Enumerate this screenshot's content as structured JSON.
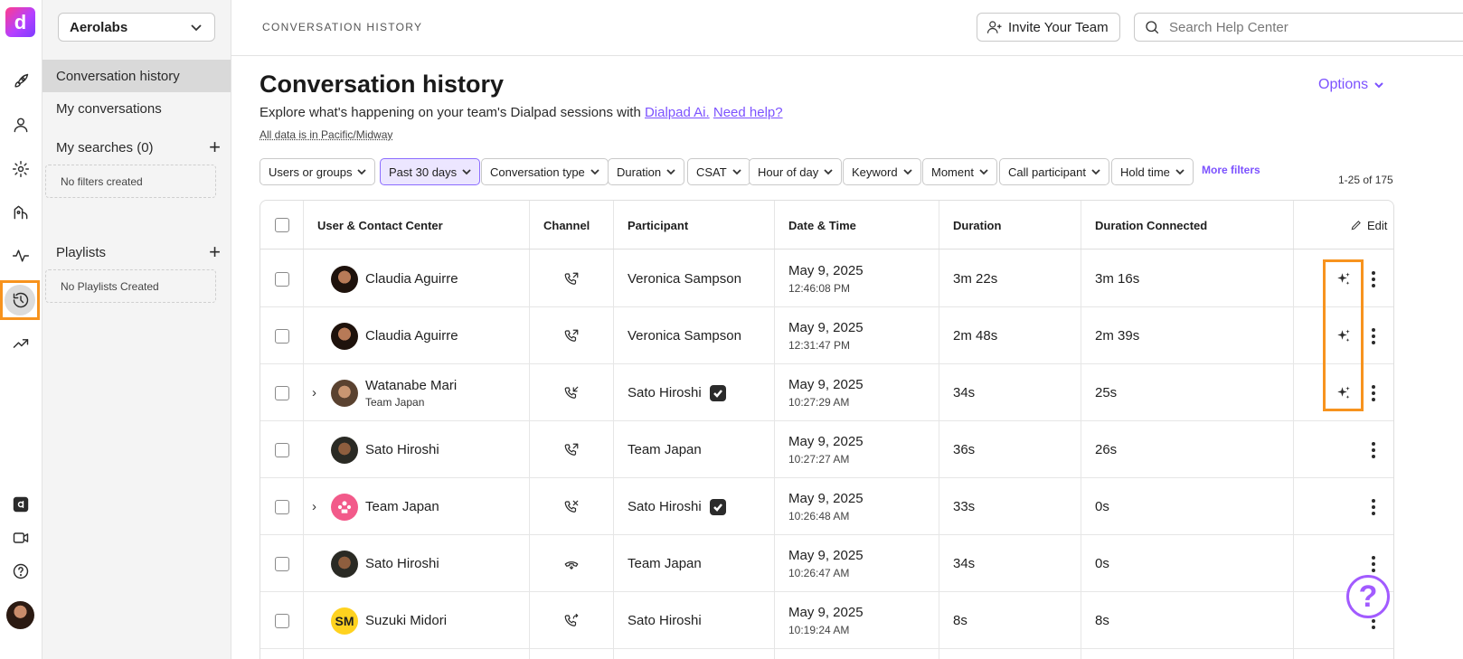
{
  "app": {
    "logo_letter": "d"
  },
  "org": {
    "name": "Aerolabs"
  },
  "subnav": {
    "items": [
      {
        "label": "Conversation history",
        "active": true
      },
      {
        "label": "My conversations",
        "active": false
      }
    ],
    "my_searches": {
      "label": "My searches (0)",
      "empty_text": "No filters created"
    },
    "playlists": {
      "label": "Playlists",
      "empty_text": "No Playlists Created"
    }
  },
  "topbar": {
    "breadcrumb": "CONVERSATION HISTORY",
    "invite_label": "Invite Your Team",
    "search_placeholder": "Search Help Center"
  },
  "page": {
    "title": "Conversation history",
    "subtitle_text": "Explore what's happening on your team's Dialpad sessions with",
    "link_ai": "Dialpad Ai.",
    "link_help": "Need help?",
    "timezone_note": "All data is in Pacific/Midway",
    "options_label": "Options"
  },
  "filters": {
    "chips": [
      {
        "label": "Users or groups",
        "selected": false
      },
      {
        "label": "Past 30 days",
        "selected": true
      },
      {
        "label": "Conversation type",
        "selected": false
      },
      {
        "label": "Duration",
        "selected": false
      },
      {
        "label": "CSAT",
        "selected": false
      },
      {
        "label": "Hour of day",
        "selected": false
      },
      {
        "label": "Keyword",
        "selected": false
      },
      {
        "label": "Moment",
        "selected": false
      },
      {
        "label": "Call participant",
        "selected": false
      },
      {
        "label": "Hold time",
        "selected": false
      }
    ],
    "more_label": "More filters",
    "count": "1-25 of 175"
  },
  "table": {
    "headers": {
      "user": "User & Contact Center",
      "channel": "Channel",
      "participant": "Participant",
      "datetime": "Date & Time",
      "duration": "Duration",
      "connected": "Duration Connected",
      "edit": "Edit"
    },
    "rows": [
      {
        "expandable": false,
        "avatar": "photo-woman",
        "name": "Claudia Aguirre",
        "sub": "",
        "channel": "outgoing-call-icon",
        "participant": "Veronica Sampson",
        "verified": false,
        "date": "May 9, 2025",
        "time": "12:46:08 PM",
        "duration": "3m 22s",
        "connected": "3m 16s",
        "ai": true
      },
      {
        "expandable": false,
        "avatar": "photo-woman",
        "name": "Claudia Aguirre",
        "sub": "",
        "channel": "outgoing-call-icon",
        "participant": "Veronica Sampson",
        "verified": false,
        "date": "May 9, 2025",
        "time": "12:31:47 PM",
        "duration": "2m 48s",
        "connected": "2m 39s",
        "ai": true
      },
      {
        "expandable": true,
        "avatar": "photo-woman-2",
        "name": "Watanabe Mari",
        "sub": "Team Japan",
        "channel": "incoming-call-icon",
        "participant": "Sato Hiroshi",
        "verified": true,
        "date": "May 9, 2025",
        "time": "10:27:29 AM",
        "duration": "34s",
        "connected": "25s",
        "ai": true
      },
      {
        "expandable": false,
        "avatar": "photo-man",
        "name": "Sato Hiroshi",
        "sub": "",
        "channel": "outgoing-call-icon",
        "participant": "Team Japan",
        "verified": false,
        "date": "May 9, 2025",
        "time": "10:27:27 AM",
        "duration": "36s",
        "connected": "26s",
        "ai": false
      },
      {
        "expandable": true,
        "avatar": "team-icon",
        "name": "Team Japan",
        "sub": "",
        "channel": "missed-call-icon",
        "participant": "Sato Hiroshi",
        "verified": true,
        "date": "May 9, 2025",
        "time": "10:26:48 AM",
        "duration": "33s",
        "connected": "0s",
        "ai": false
      },
      {
        "expandable": false,
        "avatar": "photo-man",
        "name": "Sato Hiroshi",
        "sub": "",
        "channel": "hangup-call-icon",
        "participant": "Team Japan",
        "verified": false,
        "date": "May 9, 2025",
        "time": "10:26:47 AM",
        "duration": "34s",
        "connected": "0s",
        "ai": false
      },
      {
        "expandable": false,
        "avatar": "initials",
        "initials": "SM",
        "name": "Suzuki Midori",
        "sub": "",
        "channel": "forward-call-icon",
        "participant": "Sato Hiroshi",
        "verified": false,
        "date": "May 9, 2025",
        "time": "10:19:24 AM",
        "duration": "8s",
        "connected": "8s",
        "ai": false
      }
    ]
  },
  "help_fab": {
    "label": "?"
  },
  "colors": {
    "accent": "#7c52ff",
    "highlight": "#f7931e",
    "selected_chip_bg": "#ece6ff"
  }
}
